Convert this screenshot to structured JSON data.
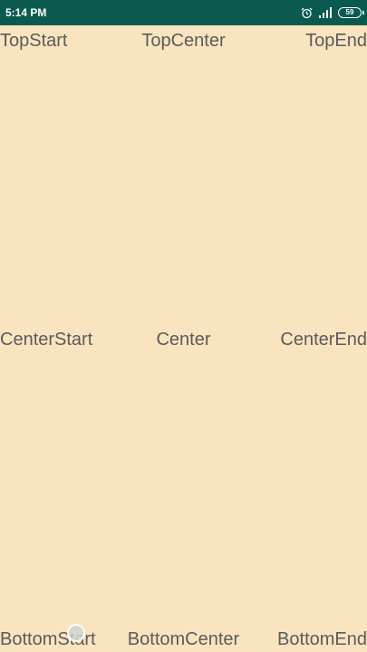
{
  "status_bar": {
    "time": "5:14 PM",
    "battery_level": "59",
    "icons": [
      "alarm-icon",
      "signal-icon",
      "battery-icon"
    ]
  },
  "labels": {
    "top_start": "TopStart",
    "top_center": "TopCenter",
    "top_end": "TopEnd",
    "center_start": "CenterStart",
    "center": "Center",
    "center_end": "CenterEnd",
    "bottom_start": "BottomStart",
    "bottom_center": "BottomCenter",
    "bottom_end": "BottomEnd"
  },
  "colors": {
    "status_bar": "#0b5a4f",
    "background": "#f9e4bf",
    "text": "#5b5b5b"
  }
}
